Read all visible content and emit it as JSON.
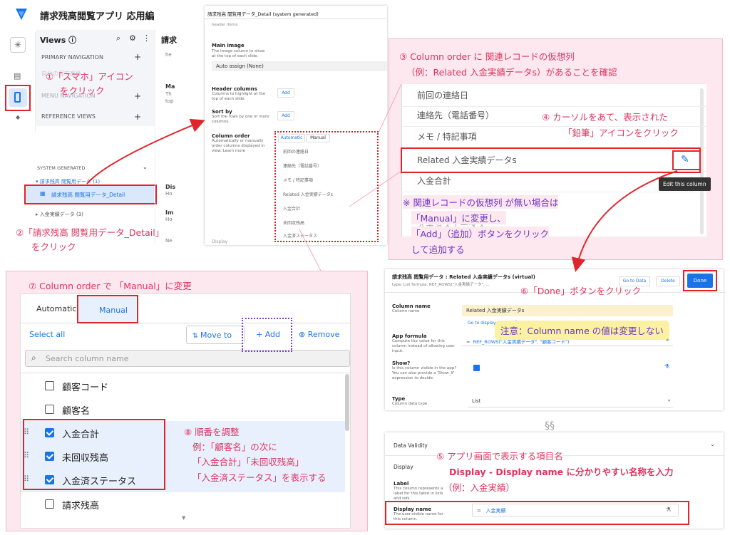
{
  "app": {
    "title": "請求残高閲覧アプリ 応用編"
  },
  "views": {
    "header": "Views",
    "primary_nav": "PRIMARY NAVIGATION",
    "faded_item": "自分の保有案件",
    "menu_nav": "MENU NAVIGATION",
    "ref_views": "REFERENCE VIEWS",
    "system_generated": "SYSTEM GENERATED",
    "group1": "▾ 請求残高 閲覧用データ (1)",
    "selected_item": "請求残高 閲覧用データ_Detail",
    "group2": "▸ 入金実績データ (3)",
    "right_fragment_title": "請求",
    "right_frag_items": [
      "he",
      "Ma",
      "Th",
      "top",
      "Dis",
      "Ho",
      "Im",
      "Ho",
      "Ne"
    ]
  },
  "notes": {
    "n1": "①「スマホ」アイコン",
    "n1b": "をクリック",
    "n2": "②「請求残高 閲覧用データ_Detail」",
    "n2b": "をクリック",
    "n3": "③ Column order に 関連レコードの仮想列",
    "n3b": "（例：Related 入金実績データs）があることを確認",
    "n4": "④ カーソルをあて、表示された",
    "n4b": "「鉛筆」アイコンをクリック",
    "n_kome": "※ 関連レコードの仮想列 が無い場合は",
    "n_kome2": "「Manual」に変更し、",
    "n_kome3": "「Add」（追加）ボタンをクリック",
    "n_kome4": "して追加する",
    "n5": "⑤ アプリ画面で表示する項目名",
    "n5b": "Display - Display name に分かりやすい名称を入力",
    "n5c": "（例：入金実績）",
    "n6": "⑥「Done」ボタンをクリック",
    "n7": "⑦ Column order で 「Manual」に変更",
    "n8": "⑧ 順番を調整",
    "n8b": "例：「顧客名」の次に",
    "n8c": "「入金合計」「未回収残高」",
    "n8d": "「入金済ステータス」を表示する",
    "caution": "注意：Column name の値は変更しない"
  },
  "detail_panel": {
    "title": "請求残高 閲覧用データ_Detail (system generated)",
    "header_items": "header items",
    "main_image": "Main image",
    "main_image_sub": "The image column to show at the top of each slide.",
    "auto_assign": "Auto assign (None)",
    "header_columns": "Header columns",
    "header_columns_sub": "Columns to highlight at the top of each slide.",
    "sort_by": "Sort by",
    "sort_by_sub": "Sort the rows by one or more columns.",
    "column_order": "Column order",
    "column_order_sub": "Automatically or manually order columns displayed in view. Learn more",
    "add": "Add",
    "tab_auto": "Automatic",
    "tab_manual": "Manual",
    "cols": [
      "前回の連絡日",
      "連絡先（電話番号）",
      "メモ / 特記事項",
      "Related 入金実績データs",
      "入金合計",
      "未回収残高",
      "入金済ステータス"
    ],
    "display_frag": "Display"
  },
  "zoom_list": {
    "items": [
      "前回の連絡日",
      "連絡先（電話番号）",
      "メモ / 特記事項",
      "Related 入金実績データs",
      "入金合計",
      "入金済ステータス"
    ],
    "tooltip": "Edit this column"
  },
  "manual_panel": {
    "tab_auto": "Automatic",
    "tab_manual": "Manual",
    "select_all": "Select all",
    "move_to": "Move to",
    "add": "+ Add",
    "remove": "Remove",
    "search_placeholder": "Search column name",
    "rows": [
      {
        "label": "顧客コード",
        "checked": false
      },
      {
        "label": "顧客名",
        "checked": false
      },
      {
        "label": "入金合計",
        "checked": true
      },
      {
        "label": "未回収残高",
        "checked": true
      },
      {
        "label": "入金済ステータス",
        "checked": true
      },
      {
        "label": "請求残高",
        "checked": false
      }
    ]
  },
  "edit_panel": {
    "title": "請求残高 閲覧用データ : Related 入金実績データs (virtual)",
    "subtitle": "type: List  formula: REF_ROWS(\"入金実績データ\", ...",
    "go_to_data": "Go to Data",
    "delete": "Delete",
    "done": "Done",
    "column_name": "Column name",
    "column_name_sub": "Column name",
    "column_name_value": "Related 入金実績データs",
    "go_to_display": "Go to display feature ⓘ",
    "app_formula": "App formula",
    "app_formula_sub": "Compute the value for this column instead of allowing user input.",
    "formula_value": "REF_ROWS(\"入金実績データ\", \"顧客コード\")",
    "show": "Show?",
    "show_sub": "Is this column visible in the app? You can also provide a 'Show_If' expression to decide.",
    "type": "Type",
    "type_sub": "Column data type",
    "type_value": "List",
    "data_validity": "Data Validity",
    "display": "Display",
    "label": "Label",
    "label_sub": "This column represents a label for this table in lists and refs.",
    "display_name": "Display name",
    "display_name_sub": "The user-visible name for this column.",
    "display_name_value": "入金実績",
    "eq": "="
  },
  "colors": {
    "accent_red": "#e0252a",
    "pink_note": "#e0335e",
    "blue": "#1a73e8",
    "purple": "#6a32c9"
  }
}
